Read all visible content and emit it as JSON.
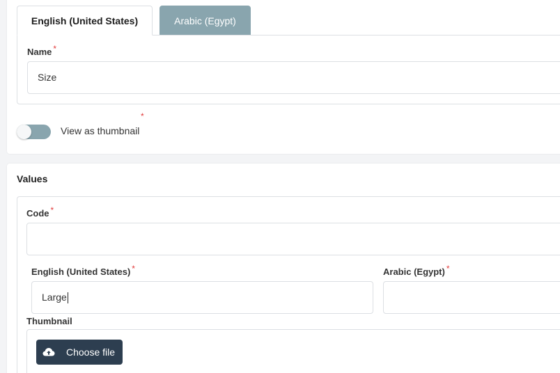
{
  "tabs": [
    {
      "label": "English (United States)",
      "active": true
    },
    {
      "label": "Arabic (Egypt)",
      "active": false
    }
  ],
  "name_field": {
    "label": "Name",
    "required": "*",
    "value": "Size"
  },
  "thumbnail_toggle": {
    "label": "View as thumbnail",
    "required": "*",
    "state": "off"
  },
  "values_section": {
    "title": "Values",
    "code_field": {
      "label": "Code",
      "required": "*",
      "value": ""
    },
    "english_field": {
      "label": "English (United States)",
      "required": "*",
      "value": "Large"
    },
    "arabic_field": {
      "label": "Arabic (Egypt)",
      "required": "*",
      "value": ""
    },
    "thumbnail": {
      "label": "Thumbnail",
      "button_label": "Choose file",
      "button_icon": "cloud-upload-icon"
    }
  },
  "colors": {
    "inactive_tab": "#89a5ae",
    "toggle_track": "#89a5ae",
    "required_mark": "#e23b3b",
    "file_button": "#2d3e50"
  }
}
